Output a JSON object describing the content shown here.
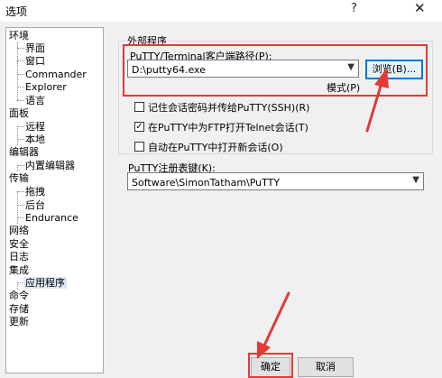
{
  "window": {
    "title": "选项",
    "help_icon": "?",
    "close_icon": "✕"
  },
  "tree": {
    "items": [
      {
        "label": "环境",
        "level": 0
      },
      {
        "label": "界面",
        "level": 1
      },
      {
        "label": "窗口",
        "level": 1
      },
      {
        "label": "Commander",
        "level": 1
      },
      {
        "label": "Explorer",
        "level": 1
      },
      {
        "label": "语言",
        "level": 1
      },
      {
        "label": "面板",
        "level": 0
      },
      {
        "label": "远程",
        "level": 1
      },
      {
        "label": "本地",
        "level": 1
      },
      {
        "label": "编辑器",
        "level": 0
      },
      {
        "label": "内置编辑器",
        "level": 1
      },
      {
        "label": "传输",
        "level": 0
      },
      {
        "label": "拖拽",
        "level": 1
      },
      {
        "label": "后台",
        "level": 1
      },
      {
        "label": "Endurance",
        "level": 1
      },
      {
        "label": "网络",
        "level": 0
      },
      {
        "label": "安全",
        "level": 0
      },
      {
        "label": "日志",
        "level": 0
      },
      {
        "label": "集成",
        "level": 0
      },
      {
        "label": "应用程序",
        "level": 1,
        "selected": true
      },
      {
        "label": "命令",
        "level": 0
      },
      {
        "label": "存储",
        "level": 0
      },
      {
        "label": "更新",
        "level": 0
      }
    ]
  },
  "external_apps": {
    "group_title": "外部程序",
    "putty_path_label": "PuTTY/Terminal客户端路径(P):",
    "putty_path_value": "D:\\putty64.exe",
    "browse_button": "浏览(B)...",
    "pattern_link": "模式(P)",
    "options": [
      {
        "label": "记住会话密码并传给PuTTY(SSH)(R)",
        "checked": false
      },
      {
        "label": "在PuTTY中为FTP打开Telnet会话(T)",
        "checked": true
      },
      {
        "label": "自动在PuTTY中打开新会话(O)",
        "checked": false
      }
    ],
    "registry_label": "PuTTY注册表键(K):",
    "registry_value": "Software\\SimonTatham\\PuTTY"
  },
  "footer": {
    "ok_button": "确定",
    "cancel_button": "取消"
  },
  "colors": {
    "annotation_red": "#e53935",
    "selection": "#dde8f6"
  }
}
